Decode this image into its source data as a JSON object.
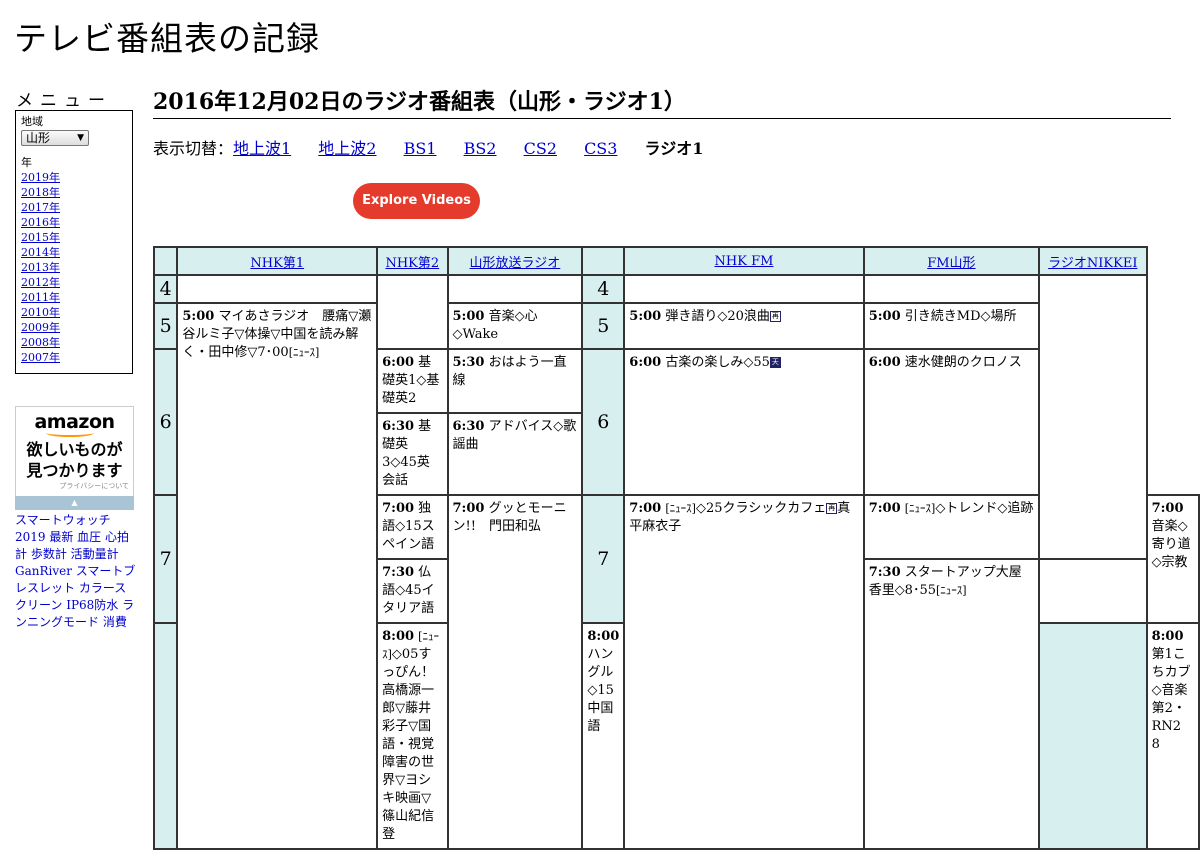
{
  "site_title": "テレビ番組表の記録",
  "menu": {
    "heading": "メニュー",
    "region_label": "地域",
    "region_value": "山形",
    "year_label": "年",
    "years": [
      "2019年",
      "2018年",
      "2017年",
      "2016年",
      "2015年",
      "2014年",
      "2013年",
      "2012年",
      "2011年",
      "2010年",
      "2009年",
      "2008年",
      "2007年"
    ]
  },
  "ad": {
    "logo": "amazon",
    "copy_line1": "欲しいものが",
    "copy_line2": "見つかります",
    "privacy": "プライバシーについて",
    "link_text": "スマートウォッチ 2019 最新 血圧 心拍計 歩数計 活動量計 GanRiver スマートブレスレット カラースクリーン IP68防水 ランニングモード 消費"
  },
  "page_title": "2016年12月02日のラジオ番組表（山形・ラジオ1）",
  "switcher": {
    "label": "表示切替：",
    "links": [
      "地上波1",
      "地上波2",
      "BS1",
      "BS2",
      "CS2",
      "CS3"
    ],
    "current": "ラジオ1"
  },
  "explore_button": "Explore Videos",
  "channels": [
    "NHK第1",
    "NHK第2",
    "山形放送ラジオ",
    "NHK FM",
    "FM山形",
    "ラジオNIKKEI"
  ],
  "hours": [
    "4",
    "5",
    "6",
    "7"
  ],
  "programs": {
    "nhk1_5": {
      "time": "5:00",
      "title": "マイあさラジオ　腰痛▽瀬谷ルミ子▽体操▽中国を読み解く・田中修▽7･00",
      "news": "[ﾆｭｰｽ]"
    },
    "nhk1_8": {
      "time": "8:00",
      "news": "[ﾆｭｰｽ]",
      "title": "◇05すっぴん！高橋源一郎▽藤井彩子▽国語・視覚障害の世界▽ヨシキ映画▽篠山紀信登"
    },
    "nhk2_600": {
      "time": "6:00",
      "title": "基礎英1◇基礎英2"
    },
    "nhk2_630": {
      "time": "6:30",
      "title": "基礎英3◇45英会話"
    },
    "nhk2_700": {
      "time": "7:00",
      "title": "独語◇15スペイン語"
    },
    "nhk2_730": {
      "time": "7:30",
      "title": "仏語◇45イタリア語"
    },
    "nhk2_800": {
      "time": "8:00",
      "title": "ハングル◇15中国語"
    },
    "ybc_500": {
      "time": "5:00",
      "title": "音楽◇心◇Wake"
    },
    "ybc_530": {
      "time": "5:30",
      "title": "おはよう一直線"
    },
    "ybc_630": {
      "time": "6:30",
      "title": "アドバイス◇歌謡曲"
    },
    "ybc_700": {
      "time": "7:00",
      "title": "グッとモーニン!!　門田和弘"
    },
    "fm_500": {
      "time": "5:00",
      "title": "弾き語り◇20浪曲",
      "mark": "再"
    },
    "fm_600": {
      "time": "6:00",
      "title": "古楽の楽しみ◇55",
      "mark": "天"
    },
    "fm_700": {
      "time": "7:00",
      "news": "[ﾆｭｰｽ]",
      "title": "◇25クラシックカフェ",
      "mark": "再",
      "title2": "真平麻衣子"
    },
    "fmy_500": {
      "time": "5:00",
      "title": "引き続きMD◇場所"
    },
    "fmy_600": {
      "time": "6:00",
      "title": "速水健朗のクロノス"
    },
    "fmy_700": {
      "time": "7:00",
      "news": "[ﾆｭｰｽ]",
      "title": "◇トレンド◇追跡"
    },
    "fmy_730": {
      "time": "7:30",
      "title": "スタートアップ大屋香里◇8･55",
      "news": "[ﾆｭｰｽ]"
    },
    "nikkei_700": {
      "time": "7:00",
      "title": "音楽◇寄り道◇宗教"
    },
    "nikkei_800": {
      "time": "8:00",
      "title": "第1こちカブ◇音楽第2・RN2　8"
    }
  }
}
